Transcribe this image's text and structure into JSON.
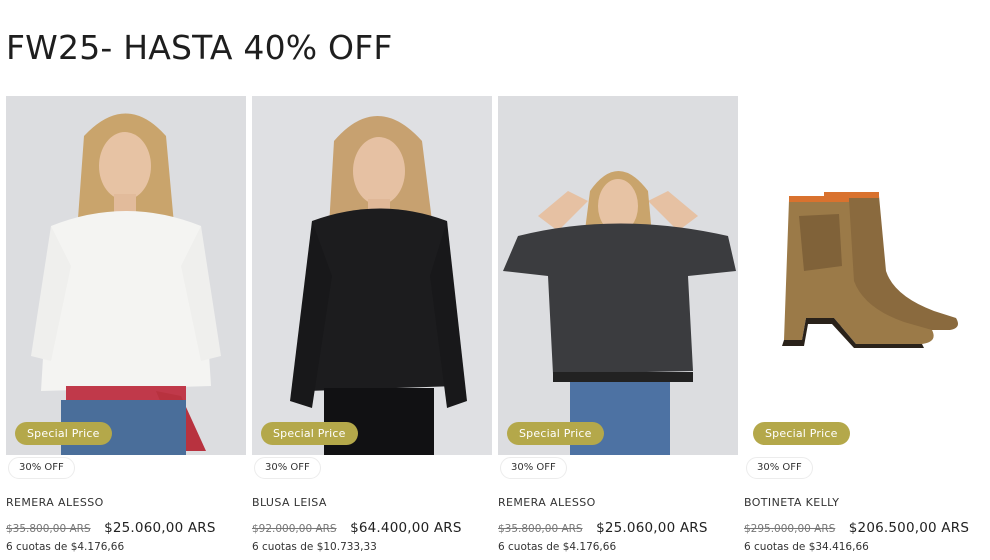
{
  "collection": {
    "title": "FW25- HASTA 40% OFF"
  },
  "products": [
    {
      "name": "REMERA ALESSO",
      "badge": "Special Price",
      "discount": "30% OFF",
      "old_price": "$35.800,00 ARS",
      "price": "$25.060,00 ARS",
      "installments": "6 cuotas de $4.176,66",
      "image": "model-white-top-photo"
    },
    {
      "name": "BLUSA LEISA",
      "badge": "Special Price",
      "discount": "30% OFF",
      "old_price": "$92.000,00 ARS",
      "price": "$64.400,00 ARS",
      "installments": "6 cuotas de $10.733,33",
      "image": "model-black-blouse-photo"
    },
    {
      "name": "REMERA ALESSO",
      "badge": "Special Price",
      "discount": "30% OFF",
      "old_price": "$35.800,00 ARS",
      "price": "$25.060,00 ARS",
      "installments": "6 cuotas de $4.176,66",
      "image": "model-grey-top-photo"
    },
    {
      "name": "BOTINETA KELLY",
      "badge": "Special Price",
      "discount": "30% OFF",
      "old_price": "$295.000,00 ARS",
      "price": "$206.500,00 ARS",
      "installments": "6 cuotas de $34.416,66",
      "image": "bronze-ankle-boots-photo"
    }
  ],
  "colors": {
    "badge": "#b4a84a",
    "photo_bg": "#dcdde0",
    "text": "#222222"
  }
}
